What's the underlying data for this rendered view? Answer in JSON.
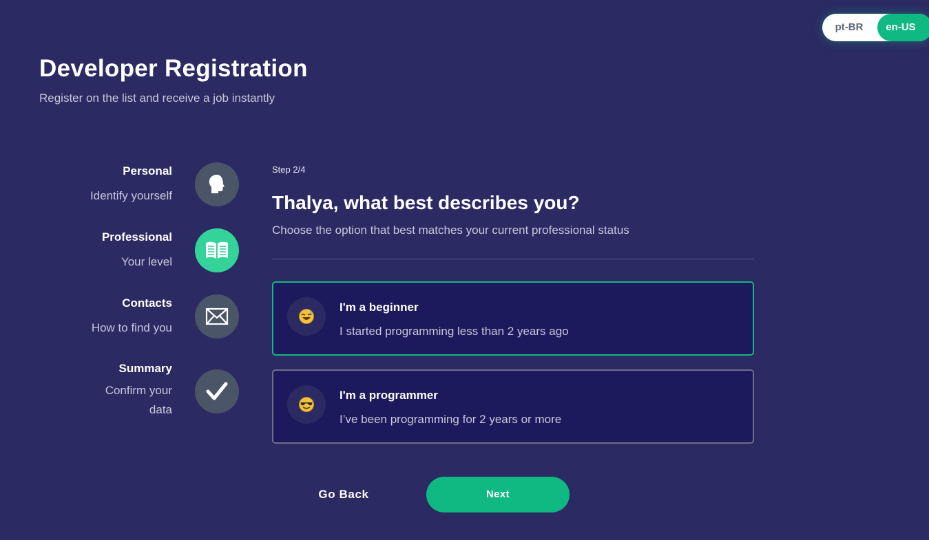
{
  "language_toggle": {
    "options": [
      "pt-BR",
      "en-US"
    ],
    "selected": "en-US"
  },
  "header": {
    "title": "Developer Registration",
    "subtitle": "Register on the list and receive a job instantly"
  },
  "stepper": {
    "active_step": 2,
    "steps": [
      {
        "label": "Personal",
        "description": "Identify yourself",
        "icon": "head-icon"
      },
      {
        "label": "Professional",
        "description": "Your level",
        "icon": "book-icon"
      },
      {
        "label": "Contacts",
        "description": "How to find you",
        "icon": "envelope-icon"
      },
      {
        "label": "Summary",
        "description": "Confirm your data",
        "icon": "checkmark-icon"
      }
    ]
  },
  "form": {
    "step_counter": "Step 2/4",
    "question": "Thalya, what best describes you?",
    "question_description": "Choose the option that best matches your current professional status",
    "options": [
      {
        "title": "I'm a beginner",
        "description": "I started programming less than 2 years ago",
        "icon": "sweat-smile-emoji-icon",
        "selected": true
      },
      {
        "title": "I'm a programmer",
        "description": "I’ve been programming for 2 years or more",
        "icon": "sunglasses-emoji-icon",
        "selected": false
      }
    ]
  },
  "actions": {
    "back_label": "Go Back",
    "next_label": "Next"
  },
  "colors": {
    "background": "#2b2a63",
    "accent": "#10b981",
    "card": "#1c1a5c",
    "inactive_icon": "#4a5568"
  }
}
